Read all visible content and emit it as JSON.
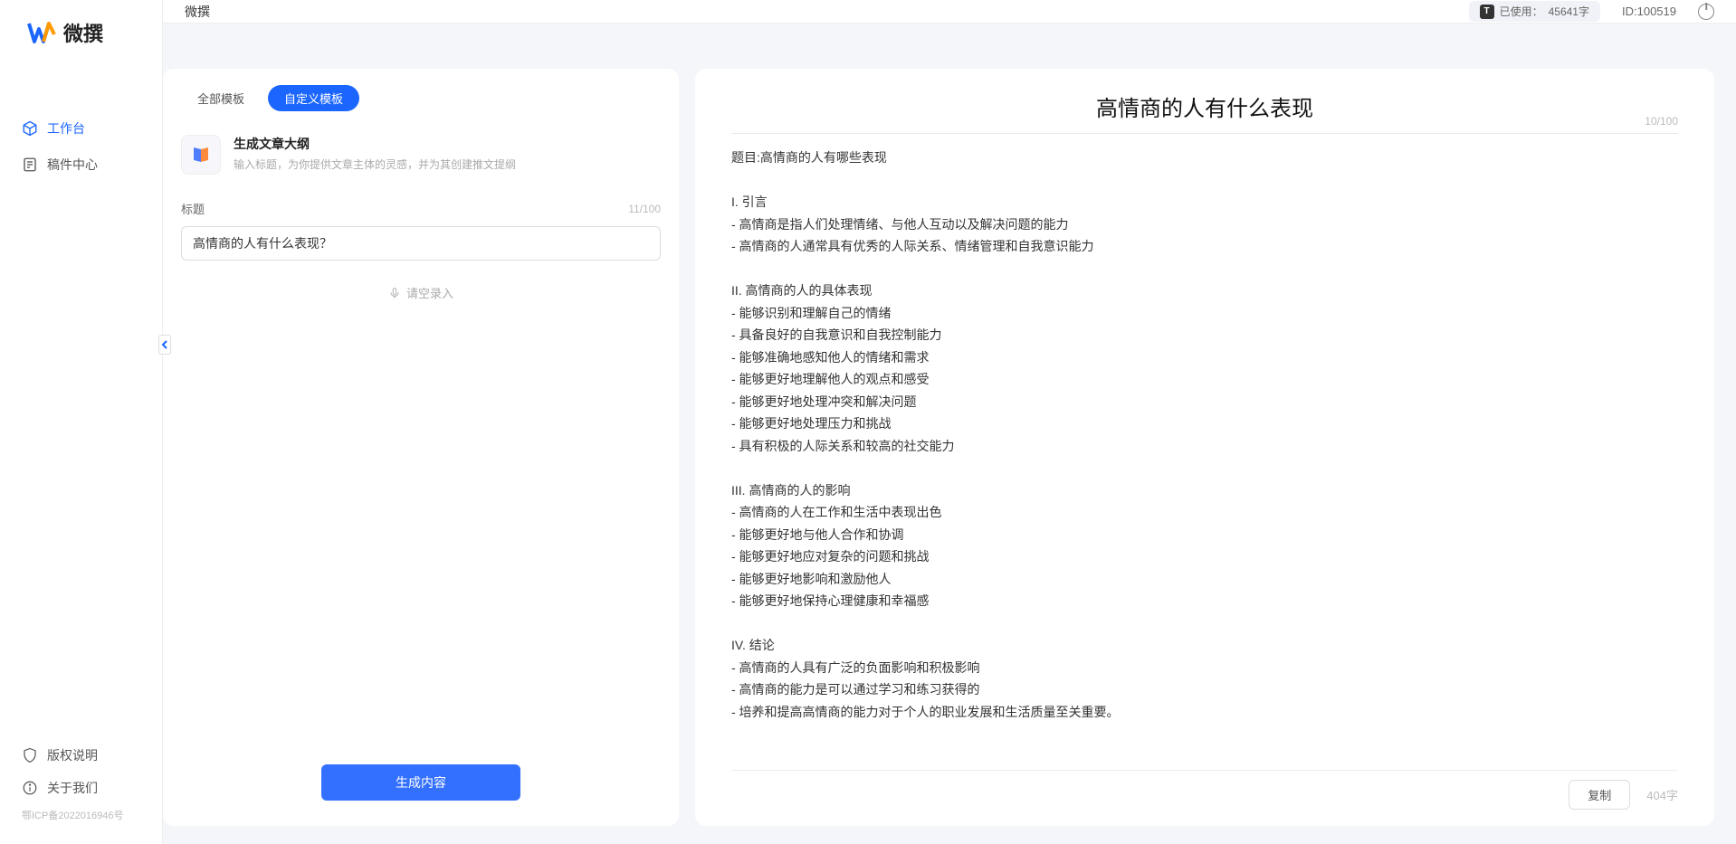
{
  "app": {
    "name": "微撰",
    "topbar_title": "微撰",
    "usage_label": "已使用：",
    "usage_value": "45641字",
    "user_id_label": "ID:",
    "user_id": "100519"
  },
  "sidebar": {
    "items": [
      {
        "label": "工作台",
        "icon": "cube-icon",
        "active": true
      },
      {
        "label": "稿件中心",
        "icon": "document-icon",
        "active": false
      }
    ],
    "bottom": [
      {
        "label": "版权说明",
        "icon": "shield-icon"
      },
      {
        "label": "关于我们",
        "icon": "info-icon"
      }
    ],
    "icp": "鄂ICP备2022016946号"
  },
  "left_panel": {
    "tabs": [
      {
        "label": "全部模板",
        "active": false
      },
      {
        "label": "自定义模板",
        "active": true
      }
    ],
    "template": {
      "title": "生成文章大纲",
      "desc": "输入标题，为你提供文章主体的灵感，并为其创建推文提纲"
    },
    "field": {
      "label": "标题",
      "counter": "11/100",
      "value": "高情商的人有什么表现？"
    },
    "voice_label": "请空录入",
    "generate_button": "生成内容"
  },
  "right_panel": {
    "title": "高情商的人有什么表现",
    "title_counter": "10/100",
    "content": "题目:高情商的人有哪些表现\n\nI. 引言\n- 高情商是指人们处理情绪、与他人互动以及解决问题的能力\n- 高情商的人通常具有优秀的人际关系、情绪管理和自我意识能力\n\nII. 高情商的人的具体表现\n- 能够识别和理解自己的情绪\n- 具备良好的自我意识和自我控制能力\n- 能够准确地感知他人的情绪和需求\n- 能够更好地理解他人的观点和感受\n- 能够更好地处理冲突和解决问题\n- 能够更好地处理压力和挑战\n- 具有积极的人际关系和较高的社交能力\n\nIII. 高情商的人的影响\n- 高情商的人在工作和生活中表现出色\n- 能够更好地与他人合作和协调\n- 能够更好地应对复杂的问题和挑战\n- 能够更好地影响和激励他人\n- 能够更好地保持心理健康和幸福感\n\nIV. 结论\n- 高情商的人具有广泛的负面影响和积极影响\n- 高情商的能力是可以通过学习和练习获得的\n- 培养和提高高情商的能力对于个人的职业发展和生活质量至关重要。",
    "copy_button": "复制",
    "char_count": "404字"
  },
  "colors": {
    "primary": "#1b66ff"
  }
}
